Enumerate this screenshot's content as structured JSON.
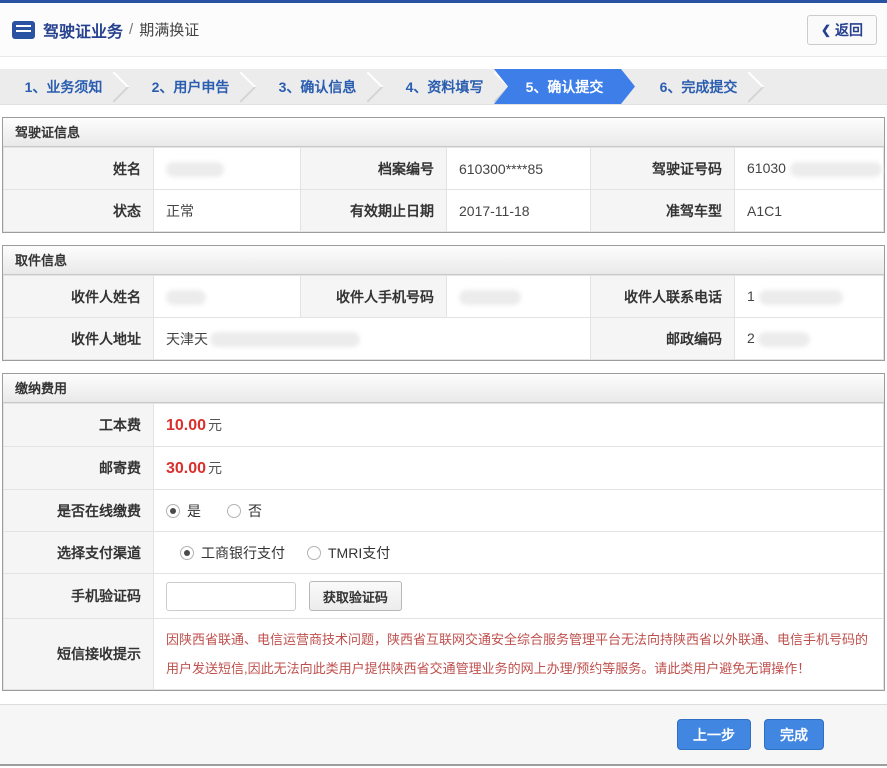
{
  "header": {
    "title_primary": "驾驶证业务",
    "title_divider": "/",
    "title_secondary": "期满换证",
    "back_chevron": "❮",
    "back_label": "返回"
  },
  "steps": [
    {
      "label": "1、业务须知",
      "active": false
    },
    {
      "label": "2、用户申告",
      "active": false
    },
    {
      "label": "3、确认信息",
      "active": false
    },
    {
      "label": "4、资料填写",
      "active": false
    },
    {
      "label": "5、确认提交",
      "active": true
    },
    {
      "label": "6、完成提交",
      "active": false
    }
  ],
  "license": {
    "section_title": "驾驶证信息",
    "name_label": "姓名",
    "name_value": "",
    "file_no_label": "档案编号",
    "file_no_value": "610300****85",
    "license_no_label": "驾驶证号码",
    "license_no_value": "61030",
    "status_label": "状态",
    "status_value": "正常",
    "expiry_label": "有效期止日期",
    "expiry_value": "2017-11-18",
    "vehicle_label": "准驾车型",
    "vehicle_value": "A1C1"
  },
  "pickup": {
    "section_title": "取件信息",
    "recipient_name_label": "收件人姓名",
    "recipient_name_value": "",
    "mobile_label": "收件人手机号码",
    "mobile_value": "",
    "phone_label": "收件人联系电话",
    "phone_value": "1",
    "address_label": "收件人地址",
    "address_value": "天津天",
    "zip_label": "邮政编码",
    "zip_value": "2"
  },
  "payment": {
    "section_title": "缴纳费用",
    "work_fee_label": "工本费",
    "work_fee_value": "10.00",
    "mail_fee_label": "邮寄费",
    "mail_fee_value": "30.00",
    "fee_unit": "元",
    "online_label": "是否在线缴费",
    "online_yes": "是",
    "online_no": "否",
    "channel_label": "选择支付渠道",
    "channel_icbc": "工商银行支付",
    "channel_tmri": "TMRI支付",
    "sms_label": "手机验证码",
    "sms_input_value": "",
    "sms_button_label": "获取验证码",
    "notice_label": "短信接收提示",
    "notice_text": "因陕西省联通、电信运营商技术问题，陕西省互联网交通安全综合服务管理平台无法向持陕西省以外联通、电信手机号码的用户发送短信,因此无法向此类用户提供陕西省交通管理业务的网上办理/预约等服务。请此类用户避免无谓操作！"
  },
  "footer": {
    "prev_label": "上一步",
    "finish_label": "完成"
  },
  "colors": {
    "top_line": "#2a52a2",
    "active_step": "#3d7ee8",
    "step_text": "#2a5db0",
    "fee_red": "#d9302c",
    "notice_red": "#bf4f4c",
    "button_blue": "#4186e0"
  }
}
